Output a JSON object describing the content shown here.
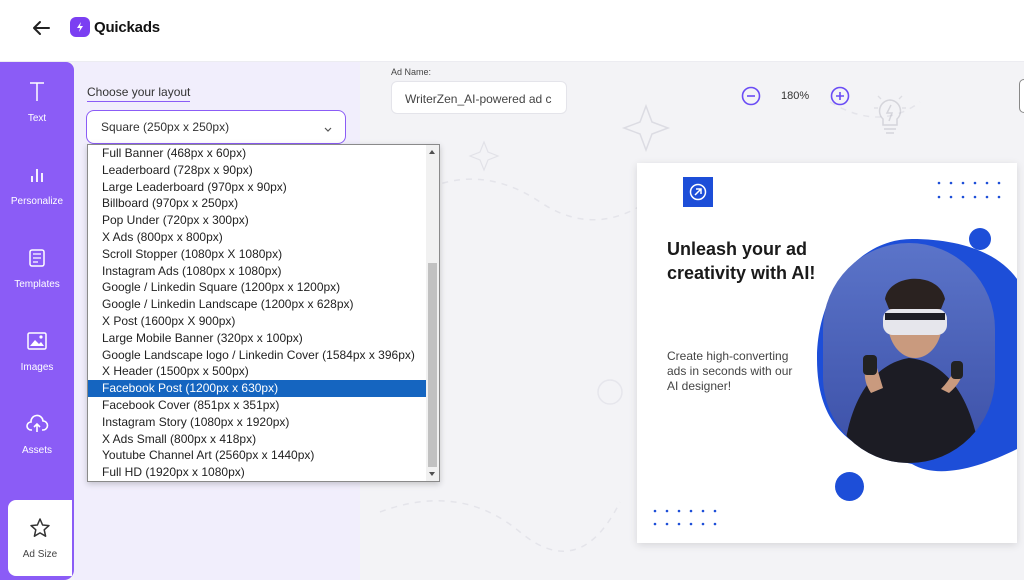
{
  "header": {
    "logo_text": "Quickads",
    "back_icon": "arrow-left-icon"
  },
  "sidebar": {
    "items": [
      {
        "label": "Text",
        "icon": "text-icon"
      },
      {
        "label": "Personalize",
        "icon": "bar-chart-icon"
      },
      {
        "label": "Templates",
        "icon": "templates-icon"
      },
      {
        "label": "Images",
        "icon": "image-icon"
      },
      {
        "label": "Assets",
        "icon": "cloud-upload-icon"
      },
      {
        "label": "Ad Size",
        "icon": "star-icon",
        "active": true
      }
    ]
  },
  "layout_panel": {
    "label": "Choose your layout",
    "selected": "Square (250px x 250px)"
  },
  "dropdown": {
    "options": [
      "Full Banner (468px x 60px)",
      "Leaderboard (728px x 90px)",
      "Large Leaderboard (970px x 90px)",
      "Billboard (970px x 250px)",
      "Pop Under (720px x 300px)",
      "X Ads (800px x 800px)",
      "Scroll Stopper (1080px X 1080px)",
      "Instagram Ads (1080px x 1080px)",
      "Google / Linkedin Square (1200px x 1200px)",
      "Google / Linkedin Landscape (1200px x 628px)",
      "X Post (1600px X 900px)",
      "Large Mobile Banner (320px x 100px)",
      "Google Landscape logo / Linkedin Cover (1584px x 396px)",
      "X Header (1500px x 500px)",
      "Facebook Post (1200px x 630px)",
      "Facebook Cover (851px x 351px)",
      "Instagram Story (1080px x 1920px)",
      "X Ads Small (800px x 418px)",
      "Youtube Channel Art (2560px x 1440px)",
      "Full HD (1920px x 1080px)"
    ],
    "highlighted": "Facebook Post (1200px x 630px)"
  },
  "ad_name": {
    "label": "Ad Name:",
    "value": "WriterZen_AI-powered ad c"
  },
  "zoom": {
    "level": "180%"
  },
  "ad_preview": {
    "headline": "Unleash your ad creativity with AI!",
    "subtext": "Create high-converting ads in seconds with our AI designer!",
    "accent_color": "#1d4ed8"
  },
  "colors": {
    "sidebar": "#8b5cf6",
    "panel": "#f1eefc",
    "selection": "#1565c0"
  }
}
